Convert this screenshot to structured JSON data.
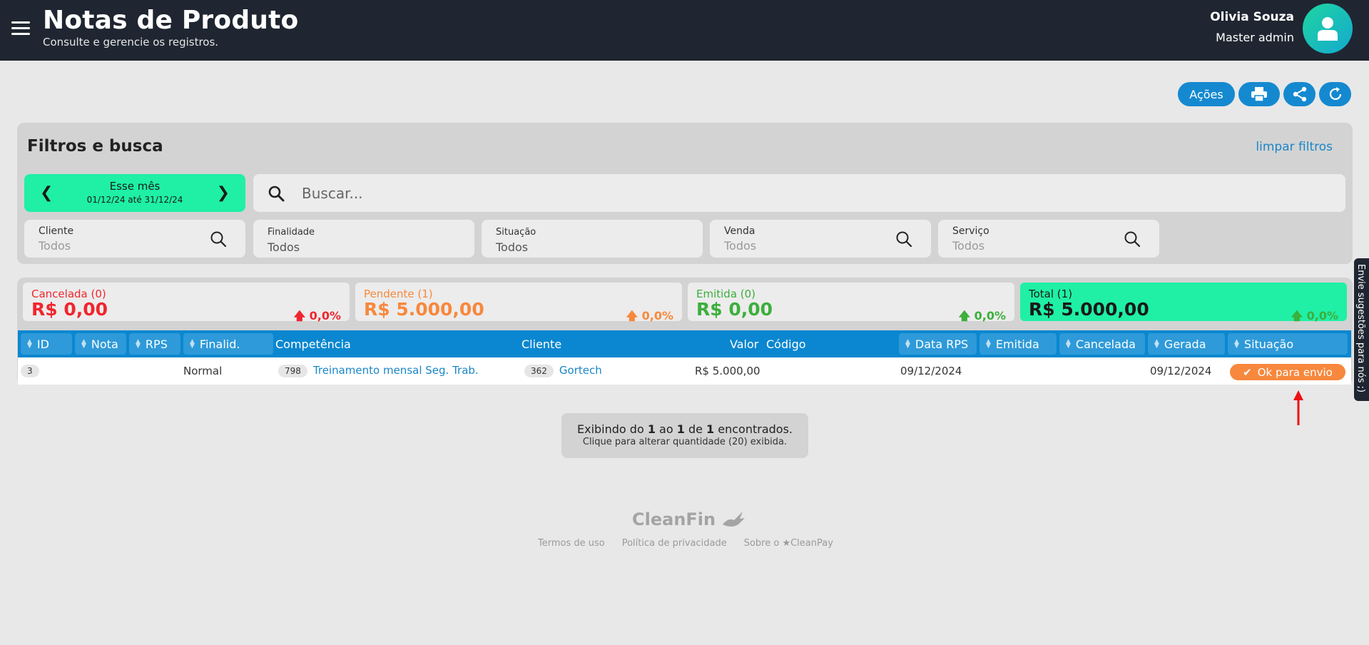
{
  "header": {
    "title": "Notas de Produto",
    "subtitle": "Consulte e gerencie os registros.",
    "user_name": "Olivia Souza",
    "user_role": "Master admin"
  },
  "actions": {
    "acoes_label": "Ações",
    "icons": [
      "print-icon",
      "share-icon",
      "refresh-icon"
    ]
  },
  "filters": {
    "title": "Filtros e busca",
    "clear_label": "limpar filtros",
    "period_label": "Esse mês",
    "period_range": "01/12/24 até 31/12/24",
    "search_placeholder": "Buscar...",
    "fields": [
      {
        "label": "Cliente",
        "value": "Todos"
      },
      {
        "label": "Finalidade",
        "value": "Todos"
      },
      {
        "label": "Situação",
        "value": "Todos"
      },
      {
        "label": "Venda",
        "value": "Todos"
      },
      {
        "label": "Serviço",
        "value": "Todos"
      }
    ]
  },
  "summary": [
    {
      "title": "Cancelada (0)",
      "value": "R$ 0,00",
      "pct": "0,0%",
      "color": "#f0262e",
      "trend": "up"
    },
    {
      "title": "Pendente (1)",
      "value": "R$ 5.000,00",
      "pct": "0,0%",
      "color": "#f7883d",
      "trend": "up"
    },
    {
      "title": "Emitida (0)",
      "value": "R$ 0,00",
      "pct": "0,0%",
      "color": "#3caf3c",
      "trend": "up"
    },
    {
      "title": "Total (1)",
      "value": "R$ 5.000,00",
      "pct": "0,0%",
      "color": "#1a1a1a",
      "trend": "up"
    }
  ],
  "table": {
    "columns": [
      "ID",
      "Nota",
      "RPS",
      "Finalid.",
      "Competência",
      "Cliente",
      "Valor",
      "Código",
      "Data RPS",
      "Emitida",
      "Cancelada",
      "Gerada",
      "Situação"
    ],
    "rows": [
      {
        "id": "3",
        "nota": "",
        "rps": "",
        "finalidade": "Normal",
        "competencia_code": "798",
        "competencia": "Treinamento mensal Seg. Trab.",
        "cliente_code": "362",
        "cliente": "Gortech",
        "valor": "R$ 5.000,00",
        "codigo": "",
        "data_rps": "09/12/2024",
        "emitida": "",
        "cancelada": "",
        "gerada": "09/12/2024",
        "situacao": "Ok para envio"
      }
    ]
  },
  "pagination": {
    "prefix": "Exibindo do ",
    "from": "1",
    "mid1": " ao ",
    "to": "1",
    "mid2": " de ",
    "total": "1",
    "suffix": " encontrados.",
    "hint": "Clique para alterar quantidade (20) exibida."
  },
  "footer": {
    "brand": "CleanFin",
    "links": [
      "Termos de uso",
      "Política de privacidade",
      "Sobre o ★CleanPay"
    ]
  },
  "feedback_tab": "Envie sugestões para nós ;)"
}
